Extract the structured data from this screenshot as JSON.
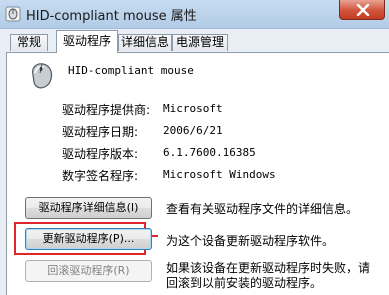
{
  "window": {
    "title": "HID-compliant mouse 属性"
  },
  "tabs": [
    {
      "label": "常规",
      "active": false
    },
    {
      "label": "驱动程序",
      "active": true
    },
    {
      "label": "详细信息",
      "active": false
    },
    {
      "label": "电源管理",
      "active": false
    }
  ],
  "device": {
    "name": "HID-compliant mouse",
    "icon": "mouse-icon"
  },
  "properties": [
    {
      "label": "驱动程序提供商:",
      "value": "Microsoft"
    },
    {
      "label": "驱动程序日期:",
      "value": "2006/6/21"
    },
    {
      "label": "驱动程序版本:",
      "value": "6.1.7600.16385"
    },
    {
      "label": "数字签名程序:",
      "value": "Microsoft Windows"
    }
  ],
  "actions": {
    "details": {
      "label": "驱动程序详细信息(I)",
      "description": "查看有关驱动程序文件的详细信息。"
    },
    "update": {
      "label": "更新驱动程序(P)...",
      "description": "为这个设备更新驱动程序软件。"
    },
    "rollback": {
      "label": "回滚驱动程序(R)",
      "description_line1": "如果该设备在更新驱动程序时失败，请",
      "description_line2": "回滚到以前安装的驱动程序。"
    }
  },
  "colors": {
    "highlight": "#e0262a",
    "titlebar": "#b2cbe6",
    "close": "#c43b21"
  }
}
